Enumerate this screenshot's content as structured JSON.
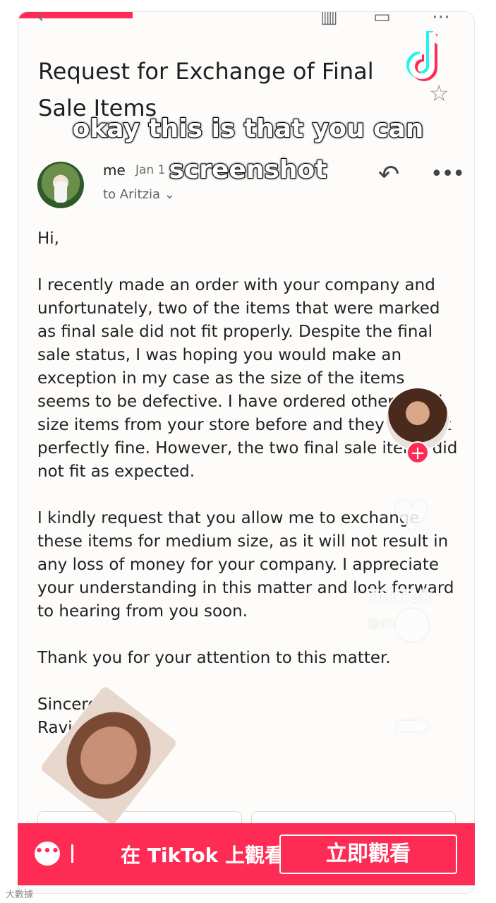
{
  "email": {
    "subject": "Request for Exchange of Final Sale Items",
    "sender": "me",
    "date": "Jan 1",
    "recipient": "to Aritzia ⌄",
    "greeting": "Hi,",
    "paragraphs": [
      "I recently made an order with your company and unfortunately, two of the items that were marked as final sale did not fit properly. Despite the final sale status, I was hoping you would make an exception in my case as the size of the items seems to be defective. I have ordered other small size items from your store before and they have fit perfectly fine. However, the two final sale items did not fit as expected.",
      "I kindly request that you allow me to exchange these items for medium size, as it will not result in any loss of money for your company. I appreciate your understanding in this matter and look forward to hearing from you soon.",
      "Thank you for your attention to this matter."
    ],
    "signoff_line1": "Sincerely,",
    "signoff_line2": "Ravi"
  },
  "video": {
    "caption_line1": "okay this is that you can",
    "caption_line2": "screenshot",
    "watermark": "TikTok",
    "watermark_user": "@sh...esy",
    "progress": 0.25
  },
  "cta": {
    "text": "在 TikTok 上觀看",
    "button": "立即觀看"
  },
  "corner_mark": "大數據",
  "icons": [
    "trash-icon",
    "mail-icon",
    "more-icon",
    "star-icon",
    "reply-icon",
    "heart-icon",
    "comment-icon",
    "share-icon",
    "tiktok-logo-icon"
  ],
  "colors": {
    "tiktok_red": "#fe2c55",
    "background": "#fdfcfa"
  }
}
